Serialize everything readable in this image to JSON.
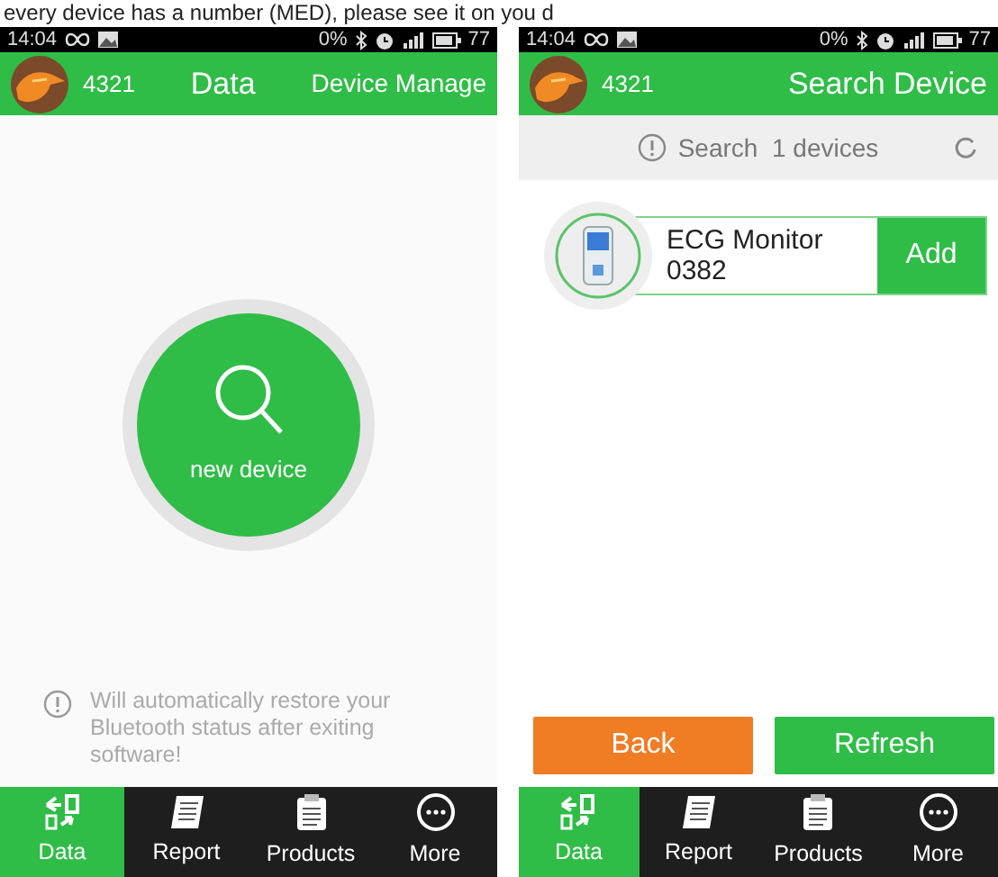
{
  "caption": "every device has a number (MED), please see it on you d",
  "screens": [
    {
      "kind": "scan",
      "status_bar": {
        "time": "14:04",
        "rate": "0%",
        "battery": "77"
      },
      "header": {
        "user": "4321",
        "title": "Data",
        "action": "Device Manage"
      },
      "scan_button": "new device",
      "notice": "Will automatically restore your Bluetooth status after exiting software!",
      "nav": [
        {
          "label": "Data",
          "selected": true
        },
        {
          "label": "Report",
          "selected": false
        },
        {
          "label": "Products",
          "selected": false
        },
        {
          "label": "More",
          "selected": false
        }
      ]
    },
    {
      "kind": "search",
      "status_bar": {
        "time": "14:04",
        "rate": "0%",
        "battery": "77"
      },
      "header": {
        "user": "4321",
        "title": "Search Device"
      },
      "search_status": "Search  1 devices",
      "devices": [
        {
          "name": "ECG Monitor 0382",
          "action": "Add"
        }
      ],
      "buttons": [
        {
          "label": "Back",
          "kind": "back"
        },
        {
          "label": "Refresh",
          "kind": "refresh"
        }
      ],
      "nav": [
        {
          "label": "Data",
          "selected": true
        },
        {
          "label": "Report",
          "selected": false
        },
        {
          "label": "Products",
          "selected": false
        },
        {
          "label": "More",
          "selected": false
        }
      ]
    }
  ]
}
